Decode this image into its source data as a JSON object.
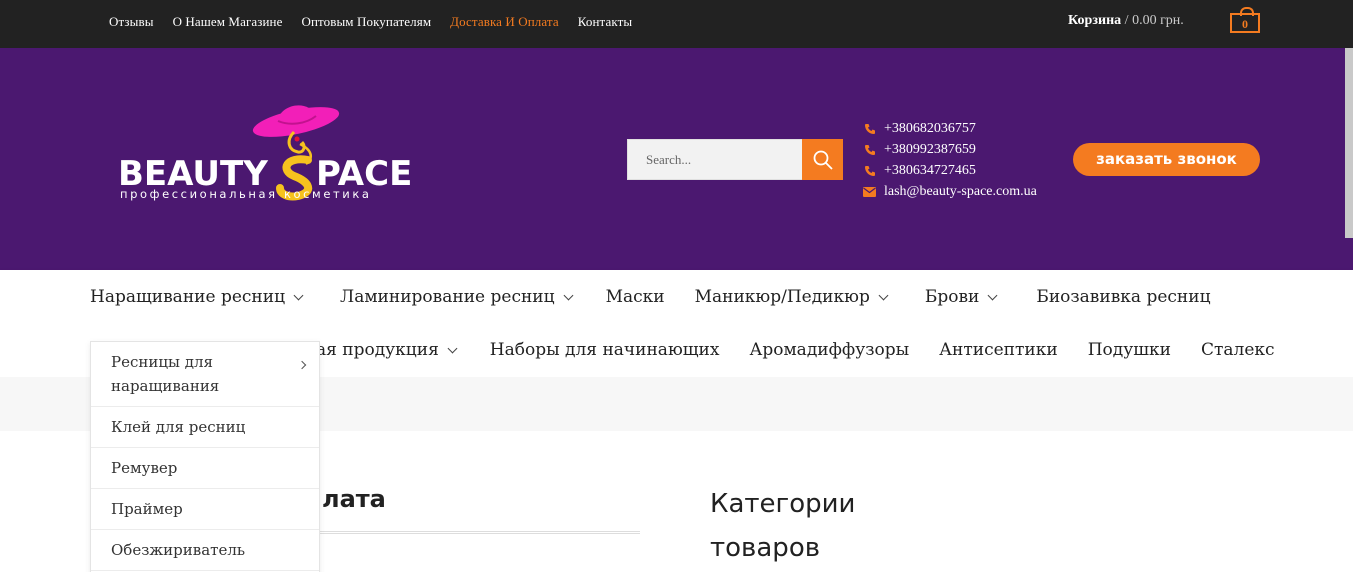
{
  "topbar": {
    "links": [
      {
        "label": "Отзывы",
        "active": false
      },
      {
        "label": "О Нашем Магазине",
        "active": false
      },
      {
        "label": "Оптовым Покупателям",
        "active": false
      },
      {
        "label": "Доставка И Оплата",
        "active": true
      },
      {
        "label": "Контакты",
        "active": false
      }
    ],
    "cart_label": "Корзина",
    "cart_separator": " / ",
    "cart_total": "0.00 грн.",
    "cart_count": "0"
  },
  "header": {
    "logo": {
      "name": "BEAUTY SPACE",
      "tagline": "профессиональная косметика"
    },
    "search_placeholder": "Search...",
    "phones": [
      "+380682036757",
      "+380992387659",
      "+380634727465"
    ],
    "email": "lash@beauty-space.com.ua",
    "call_button": "заказать звонок"
  },
  "menu": {
    "row1": [
      {
        "label": "Наращивание ресниц",
        "has_submenu": true
      },
      {
        "label": "Ламинирование ресниц",
        "has_submenu": true
      },
      {
        "label": "Маски",
        "has_submenu": false
      },
      {
        "label": "Маникюр/Педикюр",
        "has_submenu": true
      },
      {
        "label": "Брови",
        "has_submenu": true
      },
      {
        "label": "Биозавивка ресниц",
        "has_submenu": false
      }
    ],
    "row2": [
      {
        "label": "ая продукция",
        "has_submenu": true
      },
      {
        "label": "Наборы для начинающих",
        "has_submenu": false
      },
      {
        "label": "Аромадиффузоры",
        "has_submenu": false
      },
      {
        "label": "Антисептики",
        "has_submenu": false
      },
      {
        "label": "Подушки",
        "has_submenu": false
      },
      {
        "label": "Сталекс",
        "has_submenu": false
      }
    ]
  },
  "dropdown": {
    "items": [
      {
        "label": "Ресницы для наращивания",
        "has_submenu": true
      },
      {
        "label": "Клей для ресниц",
        "has_submenu": false
      },
      {
        "label": "Ремувер",
        "has_submenu": false
      },
      {
        "label": "Праймер",
        "has_submenu": false
      },
      {
        "label": "Обезжириватель",
        "has_submenu": false
      }
    ]
  },
  "content": {
    "section_title": "лата",
    "categories_title": "Категории товаров"
  },
  "colors": {
    "accent": "#f47b20",
    "header_bg": "#4b1870",
    "topbar_bg": "#222222",
    "logo_pink": "#f21fb8",
    "logo_yellow": "#f6c21e"
  }
}
